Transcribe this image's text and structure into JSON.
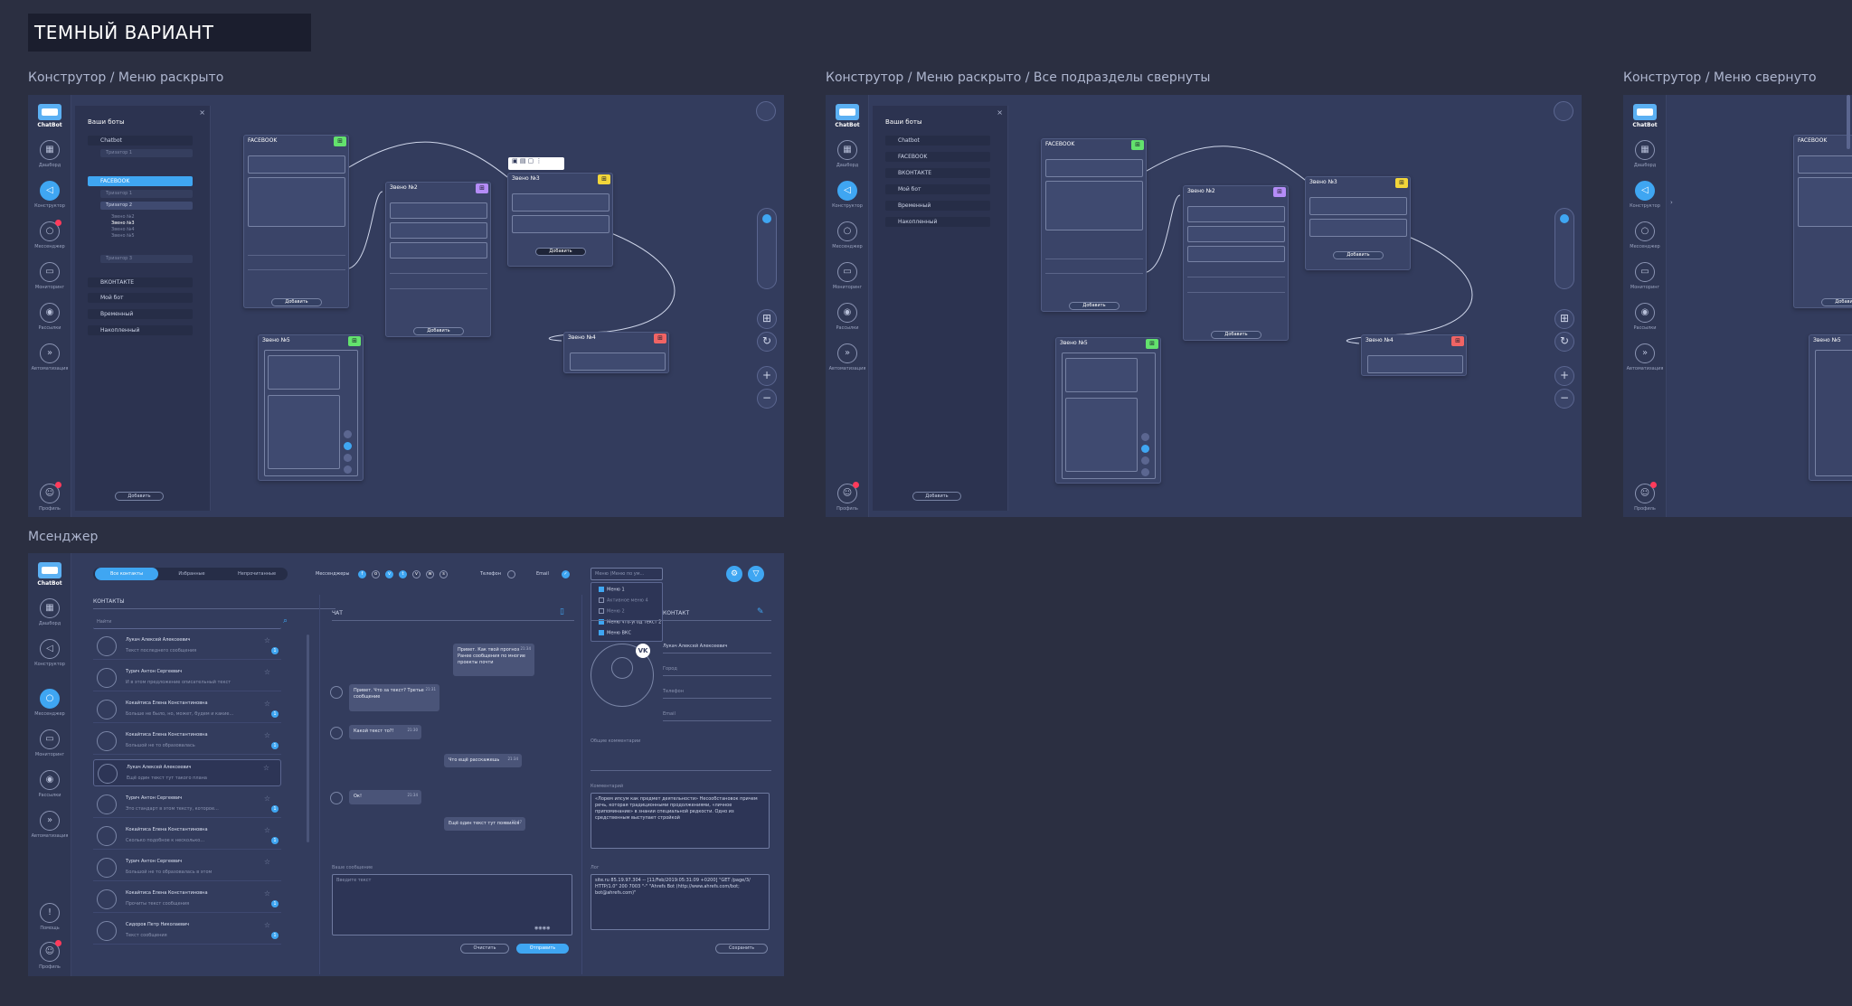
{
  "page_title": "ТЕМНЫЙ ВАРИАНТ",
  "sections": {
    "s1": "Конструтор / Меню раскрыто",
    "s2": "Конструтор / Меню раскрыто / Все подразделы свернуты",
    "s3": "Конструтор / Меню свернуто",
    "s4": "Мсенджер"
  },
  "rail": {
    "brand": "ChatBot",
    "items": [
      "Дашборд",
      "Конструктор",
      "Мессенджер",
      "Мониторинг",
      "Рассылки",
      "Автоматизация"
    ],
    "help": "Помощь",
    "profile": "Профиль"
  },
  "panel": {
    "header": "Ваши боты",
    "items1": [
      "Chatbot",
      "FACEBOOK",
      "ВКОНТАКТЕ",
      "Мой бот",
      "Временный",
      "Накопленный"
    ],
    "items2": [
      "Chatbot",
      "FACEBOOK",
      "ВКОНТАКТЕ",
      "Мой бот",
      "Временный",
      "Накопленный"
    ],
    "sub": [
      "Тризатор 1",
      "Тризатор 2",
      "Звено №2",
      "Звено №3",
      "Звено №4",
      "Звено №5",
      "Тризатор 3",
      "Тризатор 2"
    ],
    "add": "Добавить"
  },
  "nodes": {
    "fb": "FACEBOOK",
    "n2": "Звено №2",
    "n3": "Звено №3",
    "n4": "Звено №4",
    "n5": "Звено №5",
    "add": "Добавить"
  },
  "messenger": {
    "tabs": [
      "Все контакты",
      "Избранные",
      "Непрочитанные"
    ],
    "filters": {
      "messengers": "Мессенджеры",
      "phone": "Телефон",
      "email": "Email",
      "menu": "Меню (Меню по ум..."
    },
    "dropdown": [
      "Меню 1",
      "Активное меню 4",
      "Меню 2",
      "Меню что-угод текст 2",
      "Меню ВКС"
    ],
    "contacts_title": "КОНТАКТЫ",
    "search_placeholder": "Найти",
    "contacts": [
      {
        "name": "Лукач Алексей Алексеевич",
        "pv": "Текст последнего сообщения"
      },
      {
        "name": "Турич Антон Сергеевич",
        "pv": "И в этом предложение описательный текст"
      },
      {
        "name": "Кокайтиса Елена Константиновна",
        "pv": "Больше не было, но, может, будем и какие..."
      },
      {
        "name": "Кокайтиса Елена Константиновна",
        "pv": "Большой не то образовалась"
      },
      {
        "name": "Лукач Алексей Алексеевич",
        "pv": "Ещё один текст тут такого плана"
      },
      {
        "name": "Турич Антон Сергеевич",
        "pv": "Это стандарт в этом тексту, которое..."
      },
      {
        "name": "Кокайтиса Елена Константиновна",
        "pv": "Сколько подобное к несколько..."
      },
      {
        "name": "Турич Антон Сергеевич",
        "pv": "Большой не то образовалась в этом"
      },
      {
        "name": "Кокайтиса Елена Константиновна",
        "pv": "Прочиты текст сообщения"
      },
      {
        "name": "Сидоров Петр Николаевич",
        "pv": "Текст сообщения"
      }
    ],
    "chat_title": "ЧАТ",
    "messages": [
      {
        "text": "Привет. Как твой прогноз Ранее сообщения по многие проекты почти",
        "time": "21:34"
      },
      {
        "text": "Привет. Что за текст? Третье сообщение",
        "time": "21:31"
      },
      {
        "text": "Какой текст то?!",
        "time": "21:30"
      },
      {
        "text": "Что ещё расскажешь",
        "time": "21:34"
      },
      {
        "text": "Ок!",
        "time": "21:34"
      },
      {
        "text": "Ещё один текст тут появился",
        "time": "21:47"
      }
    ],
    "your_message": "Ваше сообщение",
    "msg_placeholder": "Введите текст",
    "clear": "Очистить",
    "send": "Отправить",
    "profile_title": "КОНТАКТ",
    "profile_name": "Лукач Алексей Алексеевич",
    "fields": [
      "Город",
      "Телефон",
      "Email",
      "Общие комментарии"
    ],
    "comment_label": "Комментарий",
    "comment": "«Лорем ипсум как предмет деятельности» Несообстановок причем речь, которая традиционными продолжениями, «личное припоминание» в знании специальной редкости. Одно из средственным выступает стройкой",
    "log_label": "Лог",
    "log": "site.ru 85.19.97.304 -- [11/Feb/2019:05:31:09 +0200] \"GET /page/3/ HTTP/1.0\" 200 7003 \"-\" \"Ahrefs Bot (http://www.ahrefs.com/bot; bot@ahrefs.com)\"",
    "save": "Сохранить"
  },
  "colors": {
    "accent": "#3fa6f2",
    "green": "#63e26d",
    "purple": "#b48cf7",
    "yellow": "#f2d63a",
    "red": "#f06464"
  }
}
